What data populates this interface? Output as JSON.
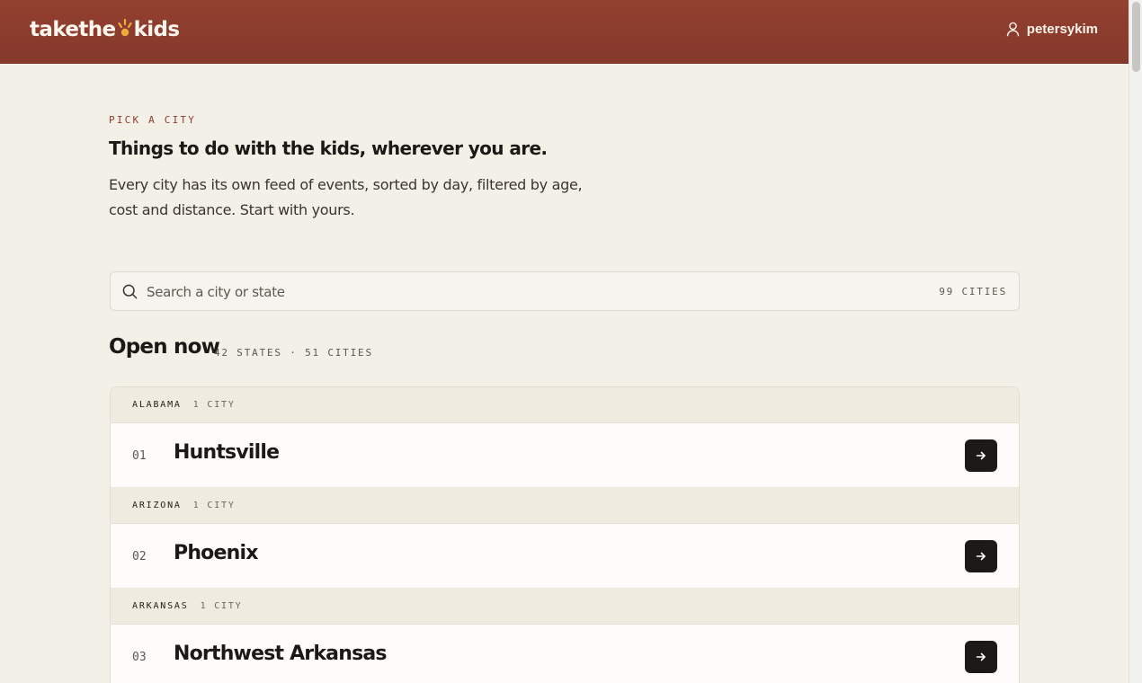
{
  "header": {
    "logo": {
      "part1": "takethe",
      "part2": "kids"
    },
    "username": "petersykim"
  },
  "intro": {
    "eyebrow": "PICK A CITY",
    "headline": "Things to do with the kids, wherever you are.",
    "description": "Every city has its own feed of events, sorted by day, filtered by age, cost and distance. Start with yours."
  },
  "search": {
    "placeholder": "Search a city or state",
    "value": "",
    "count_label": "99 CITIES"
  },
  "open_now": {
    "title": "Open now",
    "meta": "42 STATES · 51 CITIES",
    "groups": [
      {
        "state": "ALABAMA",
        "count": "1 CITY",
        "cities": [
          {
            "num": "01",
            "name": "Huntsville"
          }
        ]
      },
      {
        "state": "ARIZONA",
        "count": "1 CITY",
        "cities": [
          {
            "num": "02",
            "name": "Phoenix"
          }
        ]
      },
      {
        "state": "ARKANSAS",
        "count": "1 CITY",
        "cities": [
          {
            "num": "03",
            "name": "Northwest Arkansas"
          }
        ]
      }
    ]
  },
  "colors": {
    "header": "#8c3d2e",
    "background": "#f3f0e8",
    "accent": "#8f3b2c",
    "logo_sun": "#f2a93b",
    "button": "#1c1a17"
  },
  "icons": {
    "user": "user-icon",
    "search": "search-icon",
    "arrow": "arrow-right-icon",
    "logo_sun": "sun-icon"
  }
}
